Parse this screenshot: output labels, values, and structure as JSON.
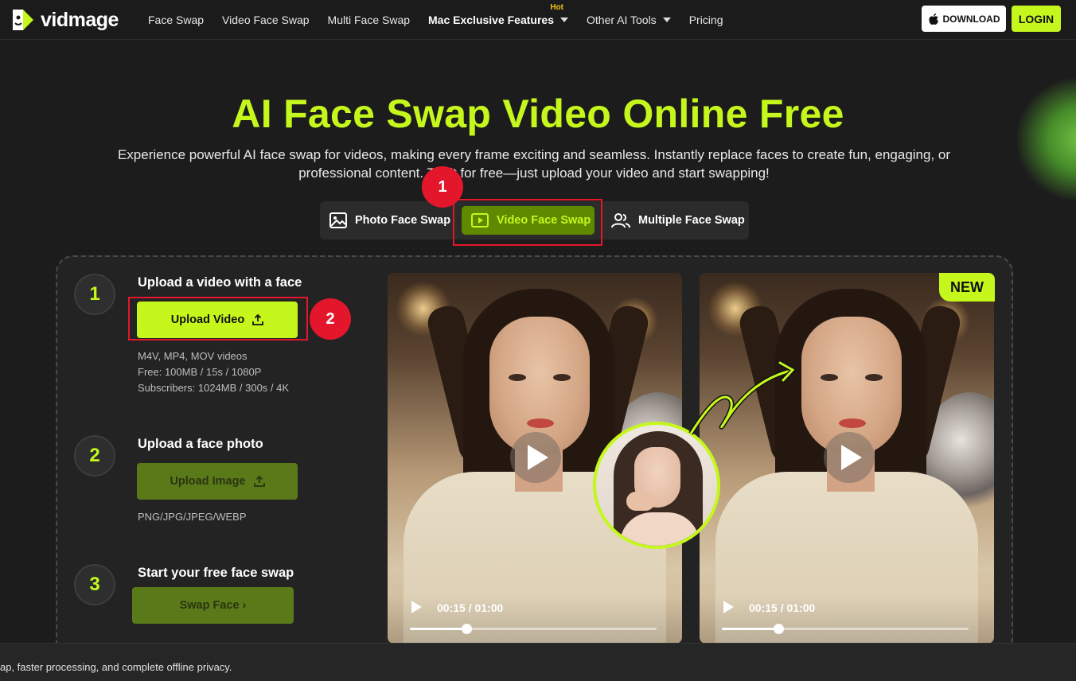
{
  "brand": {
    "name": "vidmage"
  },
  "nav": {
    "links": [
      {
        "label": "Face Swap"
      },
      {
        "label": "Video Face Swap"
      },
      {
        "label": "Multi Face Swap"
      },
      {
        "label": "Mac Exclusive Features",
        "badge": "Hot"
      },
      {
        "label": "Other AI Tools"
      },
      {
        "label": "Pricing"
      }
    ],
    "download_label": "DOWNLOAD",
    "login_label": "LOGIN"
  },
  "hero": {
    "title": "AI Face Swap Video Online Free",
    "subtitle": "Experience powerful AI face swap for videos, making every frame exciting and seamless. Instantly replace faces to create fun, engaging, or professional content. Try it for free—just upload your video and start swapping!"
  },
  "tabs": [
    {
      "label": "Photo Face Swap",
      "active": false
    },
    {
      "label": "Video Face Swap",
      "active": true
    },
    {
      "label": "Multiple Face Swap",
      "active": false
    }
  ],
  "annotations": {
    "marker_1": "1",
    "marker_2": "2"
  },
  "steps": [
    {
      "number": "1",
      "title": "Upload a video with a face",
      "button": "Upload Video",
      "notes": [
        "M4V, MP4, MOV videos",
        "Free: 100MB / 15s / 1080P",
        "Subscribers: 1024MB / 300s / 4K"
      ]
    },
    {
      "number": "2",
      "title": "Upload a face photo",
      "button": "Upload Image",
      "notes": [
        "PNG/JPG/JPEG/WEBP"
      ]
    },
    {
      "number": "3",
      "title": "Start your free face swap",
      "button": "Swap Face ›"
    }
  ],
  "preview": {
    "new_badge": "NEW",
    "left_time": "00:15 / 01:00",
    "right_time": "00:15 / 01:00",
    "progress": 0.23
  },
  "bottom_banner": {
    "text": "ap, faster processing, and complete offline privacy."
  },
  "colors": {
    "accent": "#c6f71d",
    "annotation": "#e3162c",
    "background": "#1c1c1c"
  }
}
